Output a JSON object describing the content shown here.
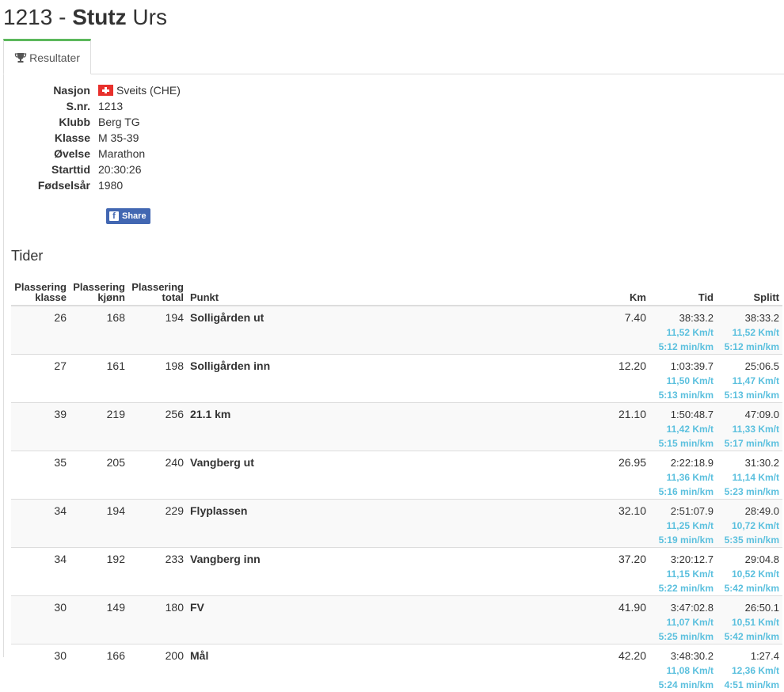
{
  "header": {
    "bib": "1213",
    "sep": " - ",
    "last_name": "Stutz",
    "first_name": "Urs"
  },
  "tabs": [
    {
      "label": "Resultater",
      "icon": "trophy-icon"
    }
  ],
  "info": {
    "nasjon_label": "Nasjon",
    "nasjon": "Sveits (CHE)",
    "snr_label": "S.nr.",
    "snr": "1213",
    "klubb_label": "Klubb",
    "klubb": "Berg TG",
    "klasse_label": "Klasse",
    "klasse": "M 35-39",
    "ovelse_label": "Øvelse",
    "ovelse": "Marathon",
    "starttid_label": "Starttid",
    "starttid": "20:30:26",
    "fodselsar_label": "Fødselsår",
    "fodselsar": "1980"
  },
  "share": {
    "label": "Share",
    "icon_letter": "f"
  },
  "colors": {
    "accent_tab": "#5cb85c",
    "speed": "#5bc0de",
    "facebook": "#4267b2",
    "flag": "#e8302c"
  },
  "tider": {
    "title": "Tider",
    "headers": {
      "pk1": "Plassering",
      "pk2": "klasse",
      "pkj1": "Plassering",
      "pkj2": "kjønn",
      "pt1": "Plassering",
      "pt2": "total",
      "punkt": "Punkt",
      "km": "Km",
      "tid": "Tid",
      "splitt": "Splitt"
    },
    "rows": [
      {
        "klasse": "26",
        "kjonn": "168",
        "total": "194",
        "punkt": "Solligården ut",
        "km": "7.40",
        "tid": "38:33.2",
        "tid_kmt": "11,52 Km/t",
        "tid_pace": "5:12 min/km",
        "splitt": "38:33.2",
        "splitt_kmt": "11,52 Km/t",
        "splitt_pace": "5:12 min/km"
      },
      {
        "klasse": "27",
        "kjonn": "161",
        "total": "198",
        "punkt": "Solligården inn",
        "km": "12.20",
        "tid": "1:03:39.7",
        "tid_kmt": "11,50 Km/t",
        "tid_pace": "5:13 min/km",
        "splitt": "25:06.5",
        "splitt_kmt": "11,47 Km/t",
        "splitt_pace": "5:13 min/km"
      },
      {
        "klasse": "39",
        "kjonn": "219",
        "total": "256",
        "punkt": "21.1 km",
        "km": "21.10",
        "tid": "1:50:48.7",
        "tid_kmt": "11,42 Km/t",
        "tid_pace": "5:15 min/km",
        "splitt": "47:09.0",
        "splitt_kmt": "11,33 Km/t",
        "splitt_pace": "5:17 min/km"
      },
      {
        "klasse": "35",
        "kjonn": "205",
        "total": "240",
        "punkt": "Vangberg ut",
        "km": "26.95",
        "tid": "2:22:18.9",
        "tid_kmt": "11,36 Km/t",
        "tid_pace": "5:16 min/km",
        "splitt": "31:30.2",
        "splitt_kmt": "11,14 Km/t",
        "splitt_pace": "5:23 min/km"
      },
      {
        "klasse": "34",
        "kjonn": "194",
        "total": "229",
        "punkt": "Flyplassen",
        "km": "32.10",
        "tid": "2:51:07.9",
        "tid_kmt": "11,25 Km/t",
        "tid_pace": "5:19 min/km",
        "splitt": "28:49.0",
        "splitt_kmt": "10,72 Km/t",
        "splitt_pace": "5:35 min/km"
      },
      {
        "klasse": "34",
        "kjonn": "192",
        "total": "233",
        "punkt": "Vangberg inn",
        "km": "37.20",
        "tid": "3:20:12.7",
        "tid_kmt": "11,15 Km/t",
        "tid_pace": "5:22 min/km",
        "splitt": "29:04.8",
        "splitt_kmt": "10,52 Km/t",
        "splitt_pace": "5:42 min/km"
      },
      {
        "klasse": "30",
        "kjonn": "149",
        "total": "180",
        "punkt": "FV",
        "km": "41.90",
        "tid": "3:47:02.8",
        "tid_kmt": "11,07 Km/t",
        "tid_pace": "5:25 min/km",
        "splitt": "26:50.1",
        "splitt_kmt": "10,51 Km/t",
        "splitt_pace": "5:42 min/km"
      },
      {
        "klasse": "30",
        "kjonn": "166",
        "total": "200",
        "punkt": "Mål",
        "km": "42.20",
        "tid": "3:48:30.2",
        "tid_kmt": "11,08 Km/t",
        "tid_pace": "5:24 min/km",
        "splitt": "1:27.4",
        "splitt_kmt": "12,36 Km/t",
        "splitt_pace": "4:51 min/km"
      }
    ]
  }
}
